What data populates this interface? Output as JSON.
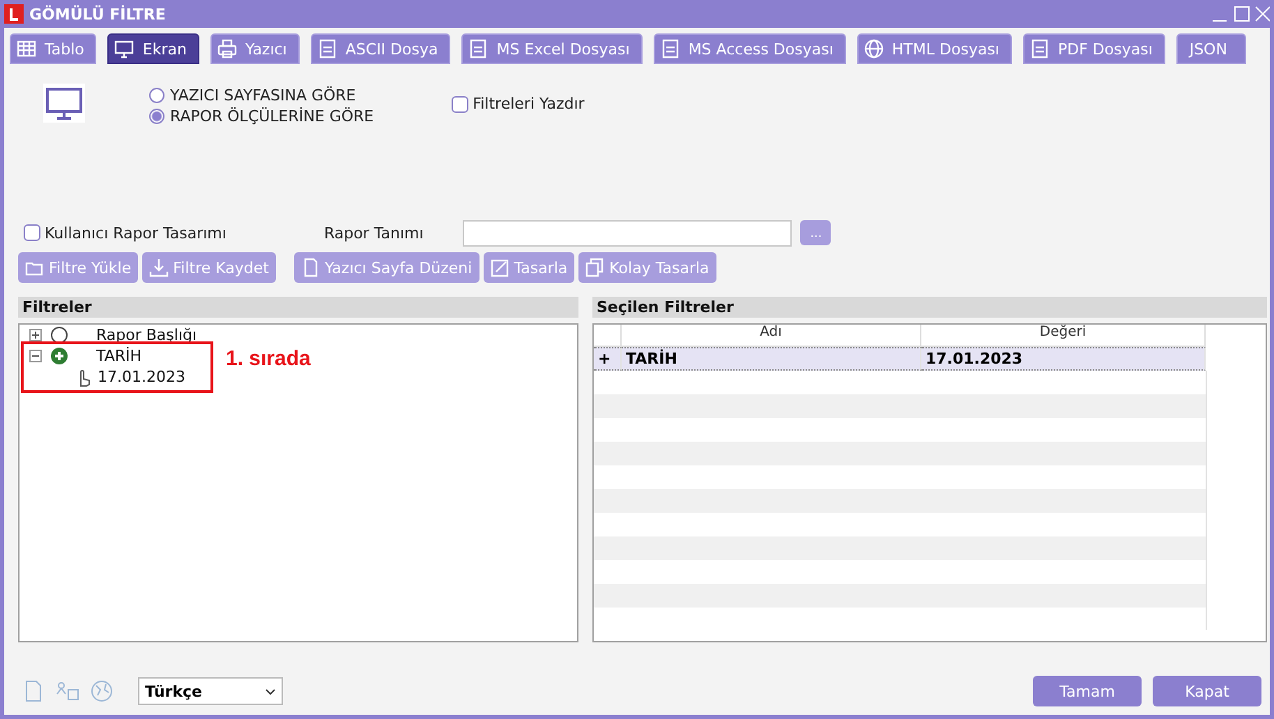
{
  "window": {
    "title": "GÖMÜLÜ FİLTRE"
  },
  "tabs": [
    {
      "label": "Tablo",
      "selected": false
    },
    {
      "label": "Ekran",
      "selected": true
    },
    {
      "label": "Yazıcı",
      "selected": false
    },
    {
      "label": "ASCII Dosya",
      "selected": false
    },
    {
      "label": "MS Excel Dosyası",
      "selected": false
    },
    {
      "label": "MS Access Dosyası",
      "selected": false
    },
    {
      "label": "HTML Dosyası",
      "selected": false
    },
    {
      "label": "PDF Dosyası",
      "selected": false
    },
    {
      "label": "JSON",
      "selected": false
    }
  ],
  "output_options": [
    {
      "label": "YAZICI SAYFASINA GÖRE",
      "selected": false
    },
    {
      "label": "RAPOR ÖLÇÜLERİNE GÖRE",
      "selected": true
    }
  ],
  "print_filters": {
    "label": "Filtreleri Yazdır",
    "checked": false
  },
  "user_design": {
    "label": "Kullanıcı Rapor Tasarımı",
    "checked": false
  },
  "report_definition": {
    "label": "Rapor Tanımı",
    "browse": "..."
  },
  "toolbar": [
    "Filtre Yükle",
    "Filtre Kaydet",
    "Yazıcı Sayfa Düzeni",
    "Tasarla",
    "Kolay Tasarla"
  ],
  "filters": {
    "title": "Filtreler",
    "tree": [
      {
        "label": "Rapor Başlığı",
        "expanded": false
      },
      {
        "label": "TARİH",
        "expanded": true,
        "children": [
          {
            "label": "17.01.2023"
          }
        ]
      }
    ]
  },
  "annotation": "1. sırada",
  "selected_filters": {
    "title": "Seçilen Filtreler",
    "columns": [
      "Adı",
      "Değeri"
    ],
    "rows": [
      {
        "marker": "+",
        "name": "TARİH",
        "value": "17.01.2023",
        "selected": true
      }
    ]
  },
  "language": "Türkçe",
  "buttons": [
    "Tamam",
    "Kapat"
  ]
}
